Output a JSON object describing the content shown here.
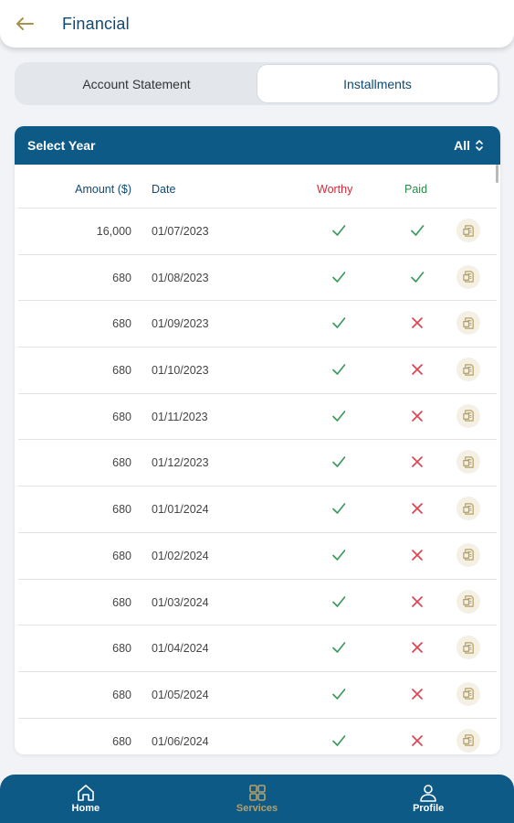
{
  "header": {
    "title": "Financial",
    "back_icon": "arrow-left-icon"
  },
  "tabs": [
    {
      "label": "Account Statement",
      "active": false
    },
    {
      "label": "Installments",
      "active": true
    }
  ],
  "card": {
    "title": "Select Year",
    "year_value": "All",
    "columns": {
      "amount": "Amount ($)",
      "date": "Date",
      "worthy": "Worthy",
      "paid": "Paid"
    },
    "rows": [
      {
        "amount": "16,000",
        "date": "01/07/2023",
        "worthy": "check",
        "paid": "check"
      },
      {
        "amount": "680",
        "date": "01/08/2023",
        "worthy": "check",
        "paid": "check"
      },
      {
        "amount": "680",
        "date": "01/09/2023",
        "worthy": "check",
        "paid": "cross"
      },
      {
        "amount": "680",
        "date": "01/10/2023",
        "worthy": "check",
        "paid": "cross"
      },
      {
        "amount": "680",
        "date": "01/11/2023",
        "worthy": "check",
        "paid": "cross"
      },
      {
        "amount": "680",
        "date": "01/12/2023",
        "worthy": "check",
        "paid": "cross"
      },
      {
        "amount": "680",
        "date": "01/01/2024",
        "worthy": "check",
        "paid": "cross"
      },
      {
        "amount": "680",
        "date": "01/02/2024",
        "worthy": "check",
        "paid": "cross"
      },
      {
        "amount": "680",
        "date": "01/03/2024",
        "worthy": "check",
        "paid": "cross"
      },
      {
        "amount": "680",
        "date": "01/04/2024",
        "worthy": "check",
        "paid": "cross"
      },
      {
        "amount": "680",
        "date": "01/05/2024",
        "worthy": "check",
        "paid": "cross"
      },
      {
        "amount": "680",
        "date": "01/06/2024",
        "worthy": "check",
        "paid": "cross"
      }
    ]
  },
  "nav": [
    {
      "label": "Home",
      "icon": "home-icon",
      "active": false
    },
    {
      "label": "Services",
      "icon": "grid-icon",
      "active": true
    },
    {
      "label": "Profile",
      "icon": "user-icon",
      "active": false
    }
  ],
  "colors": {
    "primary": "#0e5a87",
    "title_blue": "#0e4a76",
    "accent_gold": "#b5a06a",
    "worthy_red": "#d12b3a",
    "paid_green": "#2a8a4a",
    "check_green": "#3c9a5f",
    "cross_red": "#e04352"
  }
}
